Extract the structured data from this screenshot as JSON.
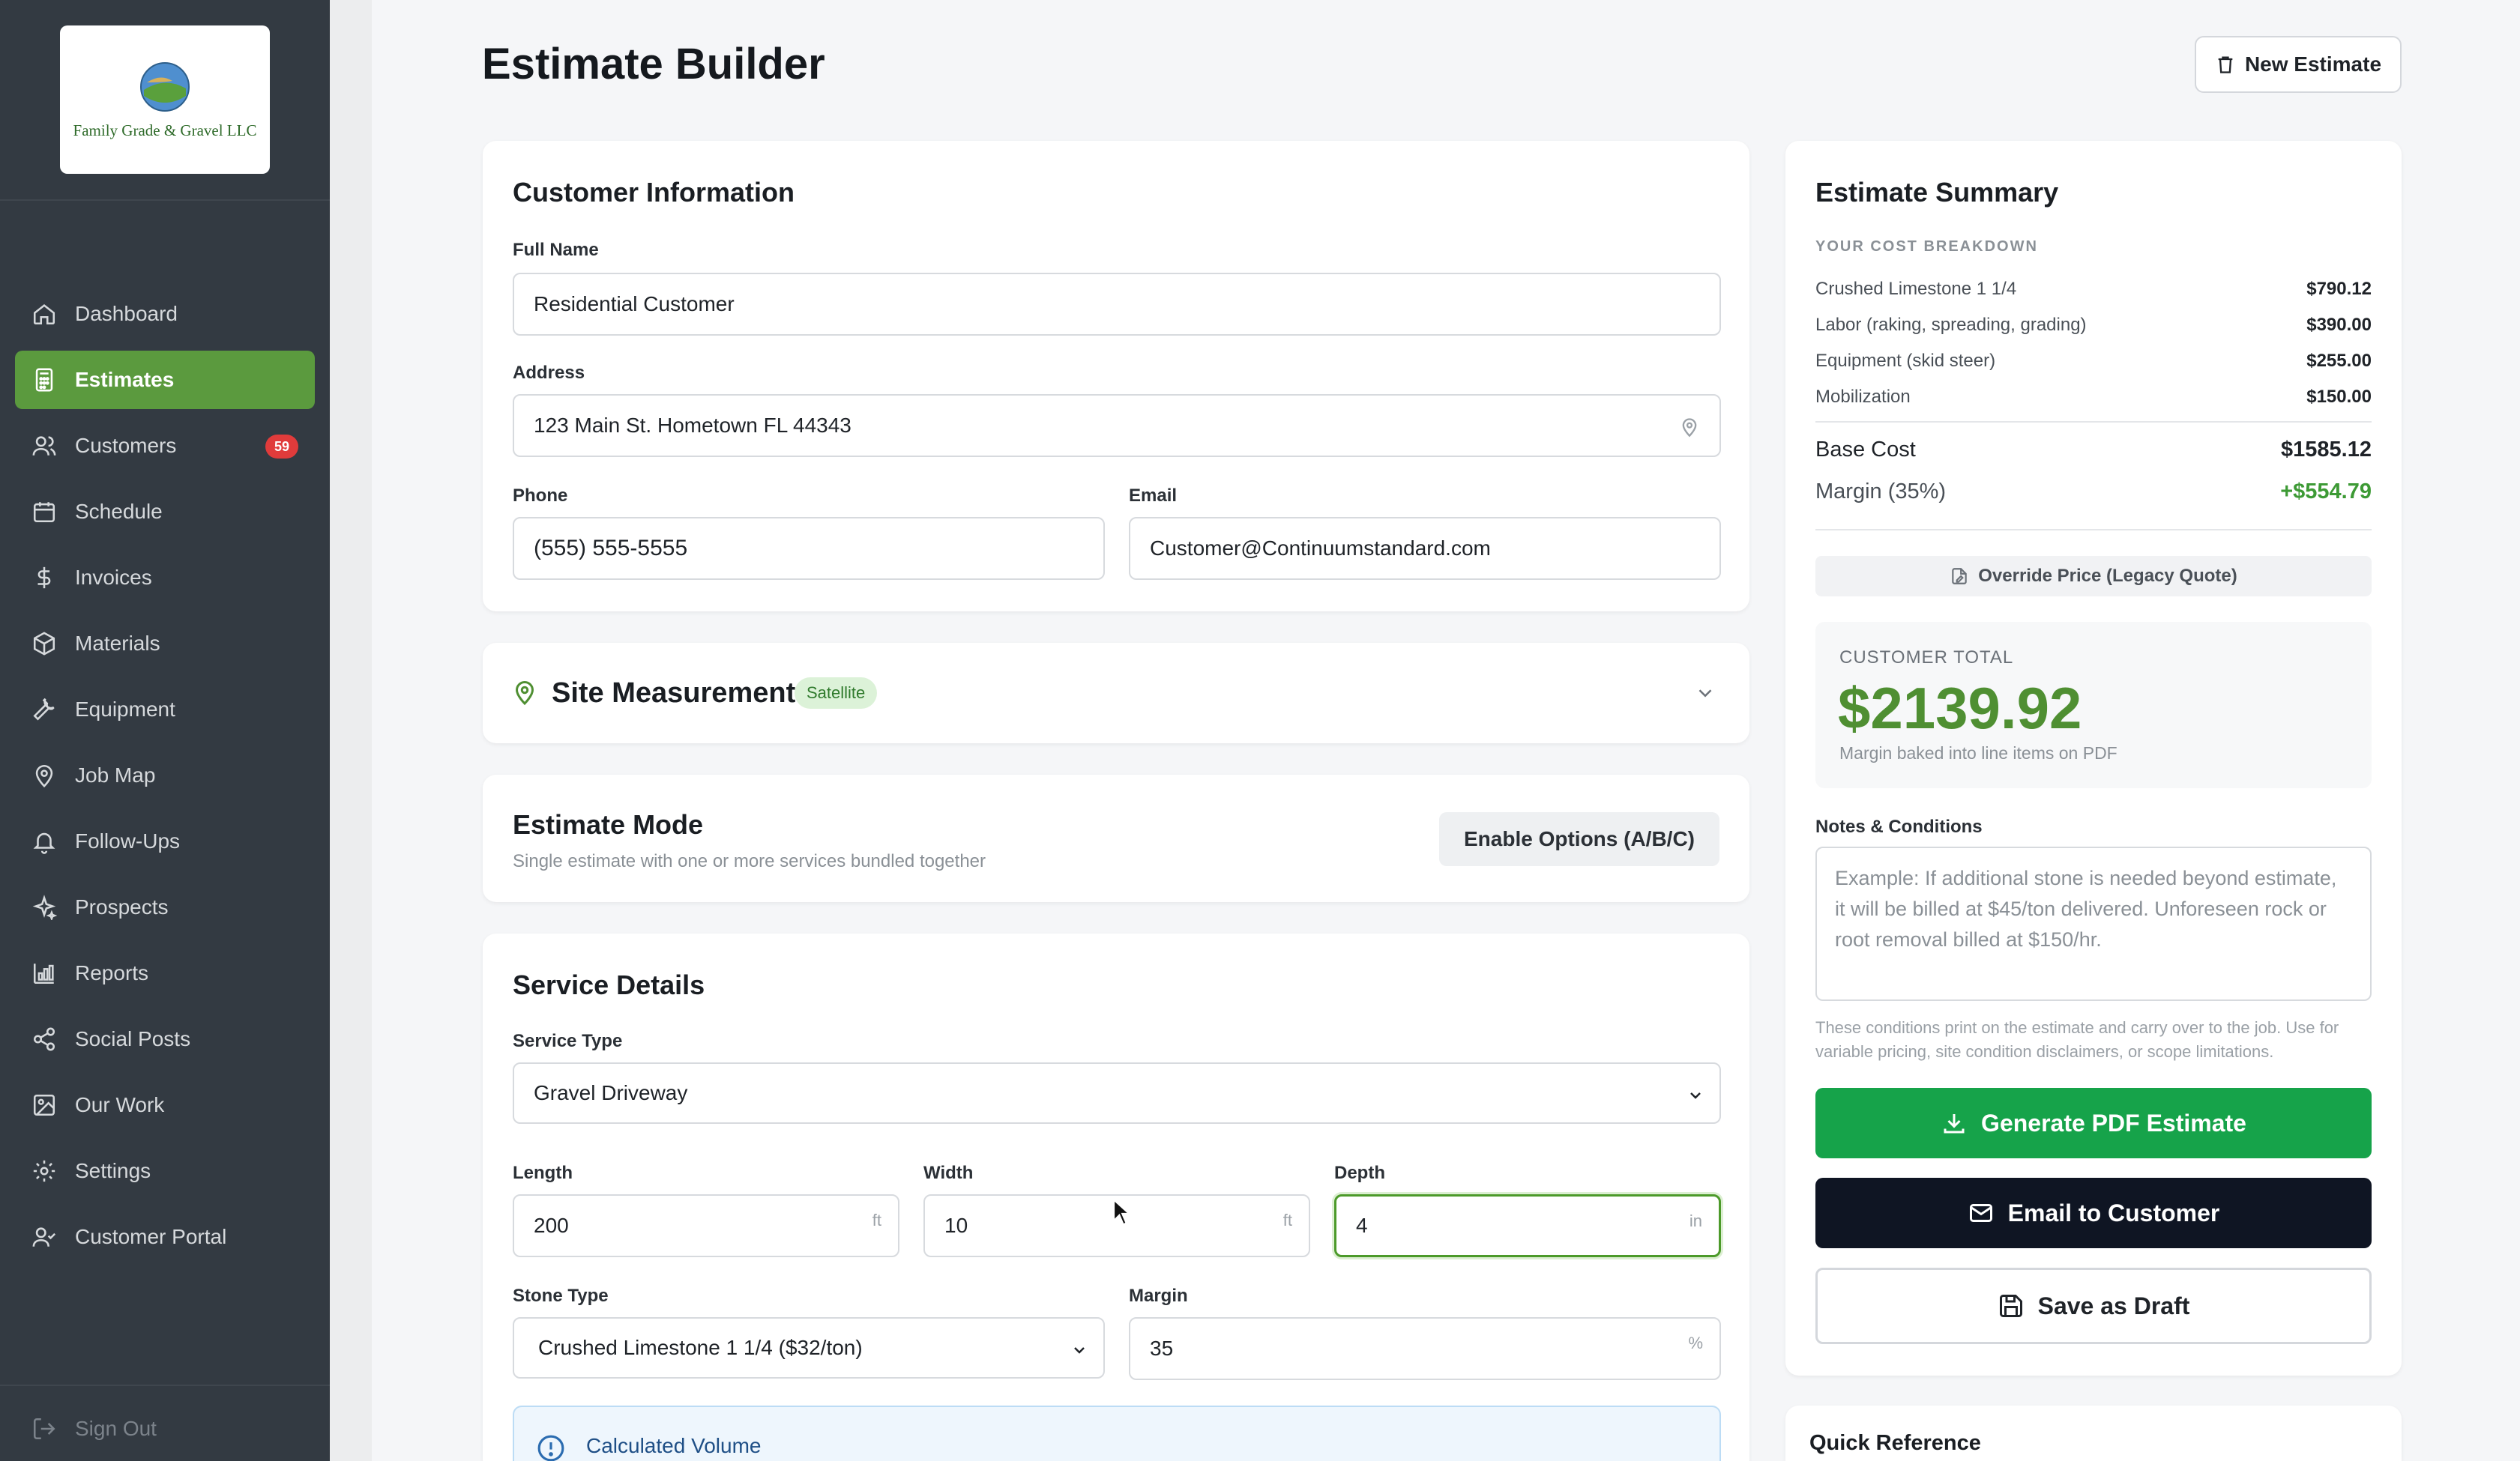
{
  "company": {
    "name": "Family Grade & Gravel LLC"
  },
  "nav": {
    "items": [
      {
        "label": "Dashboard",
        "icon": "home-icon"
      },
      {
        "label": "Estimates",
        "icon": "calculator-icon",
        "active": true
      },
      {
        "label": "Customers",
        "icon": "users-icon",
        "badge": "59"
      },
      {
        "label": "Schedule",
        "icon": "calendar-icon"
      },
      {
        "label": "Invoices",
        "icon": "dollar-icon"
      },
      {
        "label": "Materials",
        "icon": "package-icon"
      },
      {
        "label": "Equipment",
        "icon": "wrench-icon"
      },
      {
        "label": "Job Map",
        "icon": "map-pin-icon"
      },
      {
        "label": "Follow-Ups",
        "icon": "bell-icon"
      },
      {
        "label": "Prospects",
        "icon": "sparkle-icon"
      },
      {
        "label": "Reports",
        "icon": "bar-chart-icon"
      },
      {
        "label": "Social Posts",
        "icon": "share-icon"
      },
      {
        "label": "Our Work",
        "icon": "image-icon"
      },
      {
        "label": "Settings",
        "icon": "gear-icon"
      },
      {
        "label": "Customer Portal",
        "icon": "user-check-icon"
      }
    ],
    "sign_out": "Sign Out"
  },
  "header": {
    "title": "Estimate Builder",
    "new_estimate": "New Estimate"
  },
  "customer": {
    "title": "Customer Information",
    "full_name_label": "Full Name",
    "full_name": "Residential Customer",
    "address_label": "Address",
    "address": "123 Main St.  Hometown FL 44343",
    "phone_label": "Phone",
    "phone": "(555) 555-5555",
    "email_label": "Email",
    "email": "Customer@Continuumstandard.com"
  },
  "site": {
    "title": "Site Measurement",
    "badge": "Satellite"
  },
  "mode": {
    "title": "Estimate Mode",
    "subtitle": "Single estimate with one or more services bundled together",
    "options_button": "Enable Options (A/B/C)"
  },
  "service": {
    "title": "Service Details",
    "type_label": "Service Type",
    "type": "Gravel Driveway",
    "length_label": "Length",
    "length": "200",
    "length_unit": "ft",
    "width_label": "Width",
    "width": "10",
    "width_unit": "ft",
    "depth_label": "Depth",
    "depth": "4",
    "depth_unit": "in",
    "stone_label": "Stone Type",
    "stone": "Crushed Limestone 1 1/4 ($32/ton)",
    "margin_label": "Margin",
    "margin": "35",
    "margin_unit": "%",
    "calc_title": "Calculated Volume"
  },
  "summary": {
    "title": "Estimate Summary",
    "breakdown_label": "YOUR COST BREAKDOWN",
    "items": [
      {
        "label": "Crushed Limestone 1 1/4",
        "value": "$790.12"
      },
      {
        "label": "Labor (raking, spreading, grading)",
        "value": "$390.00"
      },
      {
        "label": "Equipment (skid steer)",
        "value": "$255.00"
      },
      {
        "label": "Mobilization",
        "value": "$150.00"
      }
    ],
    "base_cost_label": "Base Cost",
    "base_cost": "$1585.12",
    "margin_label": "Margin (35%)",
    "margin_value": "+$554.79",
    "override": "Override Price (Legacy Quote)",
    "customer_total_label": "CUSTOMER TOTAL",
    "customer_total": "$2139.92",
    "total_note": "Margin baked into line items on PDF",
    "notes_label": "Notes & Conditions",
    "notes_placeholder": "Example: If additional stone is needed beyond estimate, it will be billed at $45/ton delivered. Unforeseen rock or root removal billed at $150/hr.",
    "notes_help": "These conditions print on the estimate and carry over to the job. Use for variable pricing, site condition disclaimers, or scope limitations.",
    "generate_pdf": "Generate PDF Estimate",
    "email_customer": "Email to Customer",
    "save_draft": "Save as Draft"
  },
  "quick_ref": {
    "title": "Quick Reference"
  },
  "colors": {
    "accent": "#5b9a3e",
    "primary_button": "#16a34a",
    "dark_button": "#0f1523",
    "total_green": "#4f8f32"
  }
}
